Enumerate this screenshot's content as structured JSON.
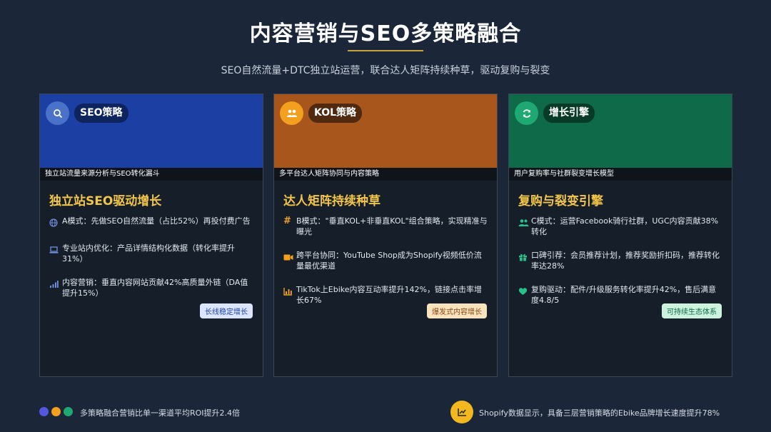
{
  "header": {
    "title": "内容营销与SEO多策略融合",
    "subtitle": "SEO自然流量+DTC独立站运营，联合达人矩阵持续种草，驱动复购与裂变"
  },
  "cards": [
    {
      "tag": "SEO策略",
      "icon": "search-icon",
      "strip": "独立站流量来源分析与SEO转化漏斗",
      "title": "独立站SEO驱动增长",
      "items": [
        {
          "icon": "globe-icon",
          "text": "A模式：先做SEO自然流量（占比52%）再投付费广告"
        },
        {
          "icon": "laptop-icon",
          "text": "专业站内优化：产品详情结构化数据（转化率提升31%）"
        },
        {
          "icon": "signal-bars-icon",
          "text": "内容营销：垂直内容网站贡献42%高质量外链（DA值提升15%）"
        }
      ],
      "badge": "长线稳定增长"
    },
    {
      "tag": "KOL策略",
      "icon": "users-icon",
      "strip": "多平台达人矩阵协同与内容策略",
      "title": "达人矩阵持续种草",
      "items": [
        {
          "icon": "hashtag-icon",
          "text": "B模式：\"垂直KOL+非垂直KOL\"组合策略，实现精准与曝光"
        },
        {
          "icon": "video-icon",
          "text": "跨平台协同：YouTube Shop成为Shopify视频低价流量最优渠道"
        },
        {
          "icon": "bar-chart-icon",
          "text": "TikTok上Ebike内容互动率提升142%，链接点击率增长67%"
        }
      ],
      "badge": "爆发式内容增长"
    },
    {
      "tag": "增长引擎",
      "icon": "refresh-icon",
      "strip": "用户复购率与社群裂变增长模型",
      "title": "复购与裂变引擎",
      "items": [
        {
          "icon": "users-icon",
          "text": "C模式：运营Facebook骑行社群，UGC内容贡献38%转化"
        },
        {
          "icon": "gift-icon",
          "text": "口碑引荐：会员推荐计划，推荐奖励折扣码，推荐转化率达28%"
        },
        {
          "icon": "heart-icon",
          "text": "复购驱动：配件/升级服务转化率提升42%，售后满意度4.8/5"
        }
      ],
      "badge": "可持续生态体系"
    }
  ],
  "footer": {
    "left_text": "多策略融合营销比单一渠道平均ROI提升2.4倍",
    "right_text": "Shopify数据显示，具备三层营销策略的Ebike品牌增长速度提升78%",
    "right_icon": "chart-line-icon"
  },
  "colors": {
    "background": "#1b2738",
    "seo_blue": "#1c3fa3",
    "kol_orange": "#a8561c",
    "growth_green": "#0f6a49",
    "title_gold": "#f3c64a"
  }
}
